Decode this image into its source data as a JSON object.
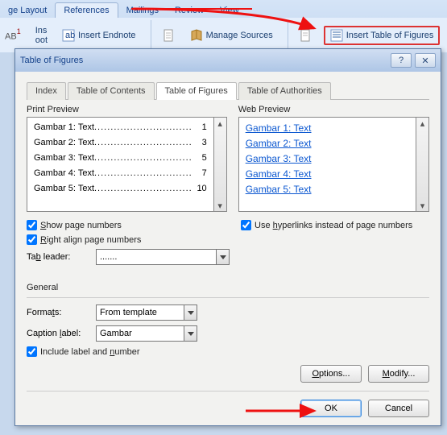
{
  "ribbon": {
    "tabs": {
      "layout": "ge Layout",
      "references": "References",
      "mailings": "Mailings",
      "review": "Review",
      "view": "View"
    },
    "ab_label": "AB",
    "insert_endnote": "Insert Endnote",
    "manage_sources": "Manage Sources",
    "insert_tof": "Insert Table of Figures",
    "ins": "Ins",
    "oot": "oot"
  },
  "dialog": {
    "title": "Table of Figures",
    "tabs": {
      "index": "Index",
      "toc": "Table of Contents",
      "tof": "Table of Figures",
      "toa": "Table of Authorities"
    },
    "print_preview_label": "Print Preview",
    "web_preview_label": "Web Preview",
    "entries": [
      {
        "label": "Gambar 1: Text",
        "page": "1"
      },
      {
        "label": "Gambar 2: Text",
        "page": "3"
      },
      {
        "label": "Gambar 3: Text",
        "page": "5"
      },
      {
        "label": "Gambar 4: Text",
        "page": "7"
      },
      {
        "label": "Gambar 5: Text",
        "page": "10"
      }
    ],
    "show_pn_pre": "S",
    "show_pn": "how page numbers",
    "right_align_pre": "R",
    "right_align": "ight align page numbers",
    "use_hyper_pre": "Use ",
    "use_hyper_u": "h",
    "use_hyper_post": "yperlinks instead of page numbers",
    "tab_leader_pre": "Ta",
    "tab_leader_u": "b",
    "tab_leader_post": " leader:",
    "tab_leader_val": ".......",
    "general_label": "General",
    "formats_pre": "Forma",
    "formats_u": "t",
    "formats_post": "s:",
    "formats_val": "From template",
    "caption_pre": "Caption ",
    "caption_u": "l",
    "caption_post": "abel:",
    "caption_val": "Gambar",
    "include_pre": "Include label and ",
    "include_u": "n",
    "include_post": "umber",
    "options_btn_pre": "O",
    "options_btn": "ptions...",
    "modify_btn_pre": "M",
    "modify_btn": "odify...",
    "ok": "OK",
    "cancel": "Cancel",
    "help": "?",
    "close": "✕"
  }
}
